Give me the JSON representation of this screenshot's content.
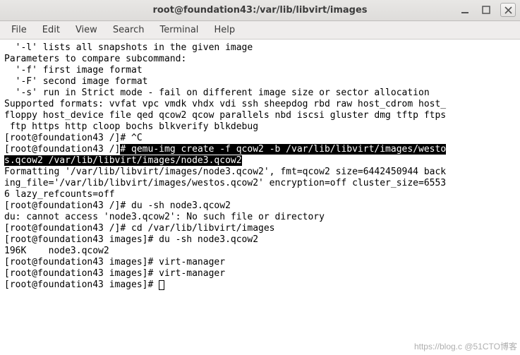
{
  "window": {
    "title": "root@foundation43:/var/lib/libvirt/images"
  },
  "menubar": {
    "items": [
      "File",
      "Edit",
      "View",
      "Search",
      "Terminal",
      "Help"
    ]
  },
  "terminal": {
    "lines": [
      {
        "t": "  '-l' lists all snapshots in the given image"
      },
      {
        "t": ""
      },
      {
        "t": "Parameters to compare subcommand:"
      },
      {
        "t": "  '-f' first image format"
      },
      {
        "t": "  '-F' second image format"
      },
      {
        "t": "  '-s' run in Strict mode - fail on different image size or sector allocation"
      },
      {
        "t": ""
      },
      {
        "t": "Supported formats: vvfat vpc vmdk vhdx vdi ssh sheepdog rbd raw host_cdrom host_"
      },
      {
        "t": "floppy host_device file qed qcow2 qcow parallels nbd iscsi gluster dmg tftp ftps"
      },
      {
        "t": " ftp https http cloop bochs blkverify blkdebug"
      },
      {
        "t": "[root@foundation43 /]# ^C"
      },
      {
        "pre": "[root@foundation43 /]",
        "hl": "# qemu-img create -f qcow2 -b /var/lib/libvirt/images/westo",
        "wrap": true
      },
      {
        "hl": "s.qcow2 /var/lib/libvirt/images/node3.qcow2"
      },
      {
        "t": "Formatting '/var/lib/libvirt/images/node3.qcow2', fmt=qcow2 size=6442450944 back"
      },
      {
        "t": "ing_file='/var/lib/libvirt/images/westos.qcow2' encryption=off cluster_size=6553"
      },
      {
        "t": "6 lazy_refcounts=off"
      },
      {
        "t": "[root@foundation43 /]# du -sh node3.qcow2"
      },
      {
        "t": "du: cannot access 'node3.qcow2': No such file or directory"
      },
      {
        "t": "[root@foundation43 /]# cd /var/lib/libvirt/images"
      },
      {
        "t": "[root@foundation43 images]# du -sh node3.qcow2"
      },
      {
        "t": "196K    node3.qcow2"
      },
      {
        "t": "[root@foundation43 images]# virt-manager"
      },
      {
        "t": "[root@foundation43 images]# virt-manager"
      },
      {
        "prompt": "[root@foundation43 images]# ",
        "cursor": true
      }
    ]
  },
  "watermark": "https://blog.c @51CTO博客"
}
